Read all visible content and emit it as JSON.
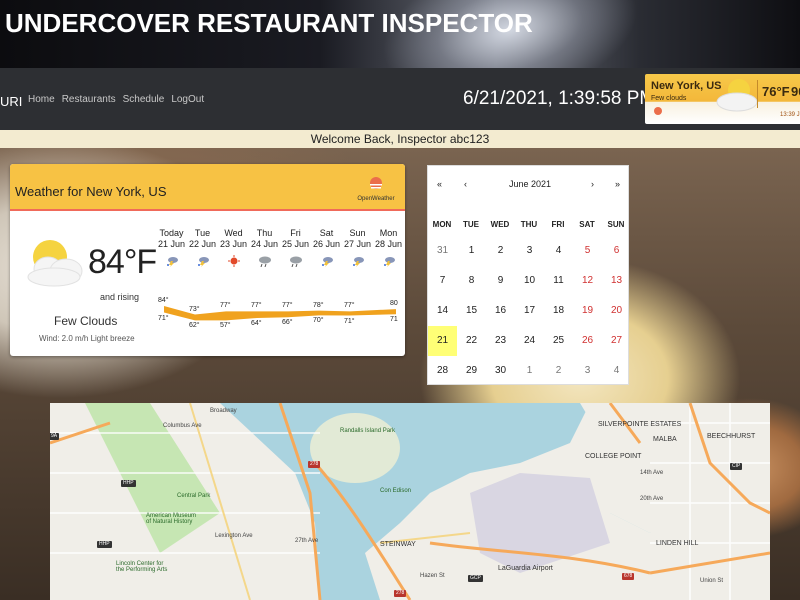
{
  "banner": {
    "title": "UNDERCOVER RESTAURANT INSPECTOR"
  },
  "nav": {
    "brand": "URI",
    "links": [
      "Home",
      "Restaurants",
      "Schedule",
      "LogOut"
    ],
    "clock": "6/21/2021, 1:39:58 PM"
  },
  "mini_weather": {
    "city": "New York, US",
    "desc": "Few clouds",
    "temp": "76°F",
    "temp2": "90",
    "time": "13:39 J"
  },
  "welcome": "Welcome Back, Inspector abc123",
  "weather": {
    "title": "Weather for New York, US",
    "provider": "OpenWeather",
    "temp": "84°F",
    "trend": "and rising",
    "condition": "Few Clouds",
    "wind": "Wind: 2.0 m/h Light breeze",
    "days": [
      {
        "name": "Today",
        "date": "21 Jun",
        "icon": "thunderstorm-icon",
        "high": "84°",
        "low": "71°"
      },
      {
        "name": "Tue",
        "date": "22 Jun",
        "icon": "thunderstorm-icon",
        "high": "73°",
        "low": "62°"
      },
      {
        "name": "Wed",
        "date": "23 Jun",
        "icon": "sun-icon",
        "high": "77°",
        "low": "57°"
      },
      {
        "name": "Thu",
        "date": "24 Jun",
        "icon": "rain-cloud-icon",
        "high": "77°",
        "low": "64°"
      },
      {
        "name": "Fri",
        "date": "25 Jun",
        "icon": "rain-cloud-icon",
        "high": "77°",
        "low": "66°"
      },
      {
        "name": "Sat",
        "date": "26 Jun",
        "icon": "thunderstorm-icon",
        "high": "78°",
        "low": "70°"
      },
      {
        "name": "Sun",
        "date": "27 Jun",
        "icon": "thunderstorm-icon",
        "high": "77°",
        "low": "71°"
      },
      {
        "name": "Mon",
        "date": "28 Jun",
        "icon": "thunderstorm-icon",
        "high": "80",
        "low": "71"
      }
    ]
  },
  "calendar": {
    "prev_year": "«",
    "prev_month": "‹",
    "month": "June 2021",
    "next_month": "›",
    "next_year": "»",
    "dow": [
      "MON",
      "TUE",
      "WED",
      "THU",
      "FRI",
      "SAT",
      "SUN"
    ],
    "weeks": [
      [
        "31",
        "1",
        "2",
        "3",
        "4",
        "5",
        "6"
      ],
      [
        "7",
        "8",
        "9",
        "10",
        "11",
        "12",
        "13"
      ],
      [
        "14",
        "15",
        "16",
        "17",
        "18",
        "19",
        "20"
      ],
      [
        "21",
        "22",
        "23",
        "24",
        "25",
        "26",
        "27"
      ],
      [
        "28",
        "29",
        "30",
        "1",
        "2",
        "3",
        "4"
      ]
    ],
    "selected": "21"
  },
  "map": {
    "labels": [
      {
        "text": "Central Park",
        "kind": "poi"
      },
      {
        "text": "American Museum of Natural History",
        "kind": "poi"
      },
      {
        "text": "Lincoln Center for the Performing Arts",
        "kind": "poi"
      },
      {
        "text": "Randalls Island Park",
        "kind": "poi"
      },
      {
        "text": "Con Edison",
        "kind": "poi"
      },
      {
        "text": "STEINWAY",
        "kind": "area"
      },
      {
        "text": "LaGuardia Airport",
        "kind": "area"
      },
      {
        "text": "SILVERPOINTE ESTATES",
        "kind": "area"
      },
      {
        "text": "COLLEGE POINT",
        "kind": "area"
      },
      {
        "text": "MALBA",
        "kind": "area"
      },
      {
        "text": "BEECHHURST",
        "kind": "area"
      },
      {
        "text": "LINDEN HILL",
        "kind": "area"
      },
      {
        "text": "27th Ave",
        "kind": "street"
      },
      {
        "text": "20th Ave",
        "kind": "street"
      },
      {
        "text": "14th Ave",
        "kind": "street"
      },
      {
        "text": "Lexington Ave",
        "kind": "street"
      },
      {
        "text": "Union St",
        "kind": "street"
      },
      {
        "text": "Broadway",
        "kind": "street"
      },
      {
        "text": "Columbus Ave",
        "kind": "street"
      },
      {
        "text": "Hazen St",
        "kind": "street"
      }
    ],
    "shields": [
      "9A",
      "HHP",
      "HHP",
      "278",
      "678",
      "CIP",
      "GCP",
      "278"
    ]
  },
  "colors": {
    "weather_header": "#f7c244",
    "weather_accent": "#f06a5a",
    "temp_band": "#f0a21e",
    "today_highlight": "#ffff76",
    "weekend": "#d03030"
  }
}
